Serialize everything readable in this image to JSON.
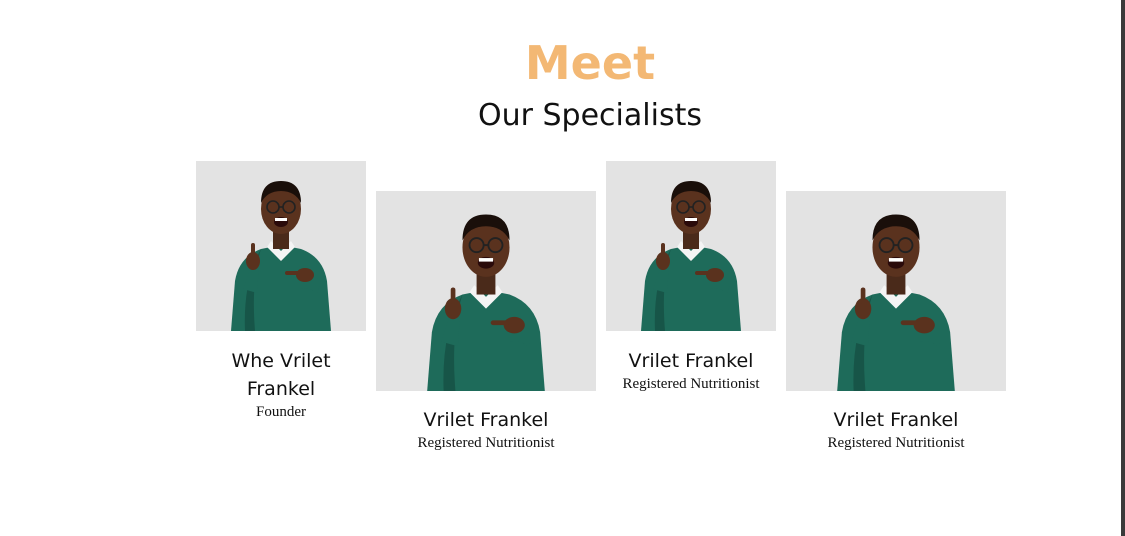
{
  "heading": {
    "title": "Meet",
    "subtitle": "Our Specialists"
  },
  "colors": {
    "accent": "#f3b874",
    "photo_background": "#e3e3e3",
    "sweater": "#1e6b5a"
  },
  "specialists": [
    {
      "name": "Whe Vrilet Frankel",
      "role": "Founder",
      "icon": "specialist-photo"
    },
    {
      "name": "Vrilet Frankel",
      "role": "Registered Nutritionist",
      "icon": "specialist-photo"
    },
    {
      "name": "Vrilet Frankel",
      "role": "Registered Nutritionist",
      "icon": "specialist-photo"
    },
    {
      "name": "Vrilet Frankel",
      "role": "Registered Nutritionist",
      "icon": "specialist-photo"
    }
  ]
}
